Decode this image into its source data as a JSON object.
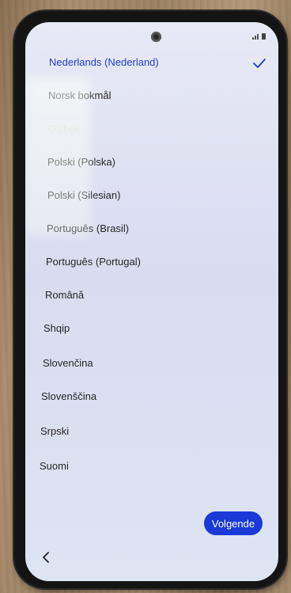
{
  "languages": {
    "selected": "Nederlands (Nederland)",
    "items": [
      "Norsk bokmål",
      "O'zbek",
      "Polski (Polska)",
      "Polski (Silesian)",
      "Português (Brasil)",
      "Português (Portugal)",
      "Română",
      "Shqip",
      "Slovenčina",
      "Slovenščina",
      "Srpski",
      "Suomi"
    ]
  },
  "footer": {
    "next_label": "Volgende"
  },
  "colors": {
    "accent": "#1a39d6",
    "selected_text": "#1e3cc8"
  },
  "icons": {
    "check": "check-icon",
    "back": "back-chevron-icon",
    "camera": "front-camera-icon",
    "signal": "signal-icon",
    "battery": "battery-icon"
  }
}
